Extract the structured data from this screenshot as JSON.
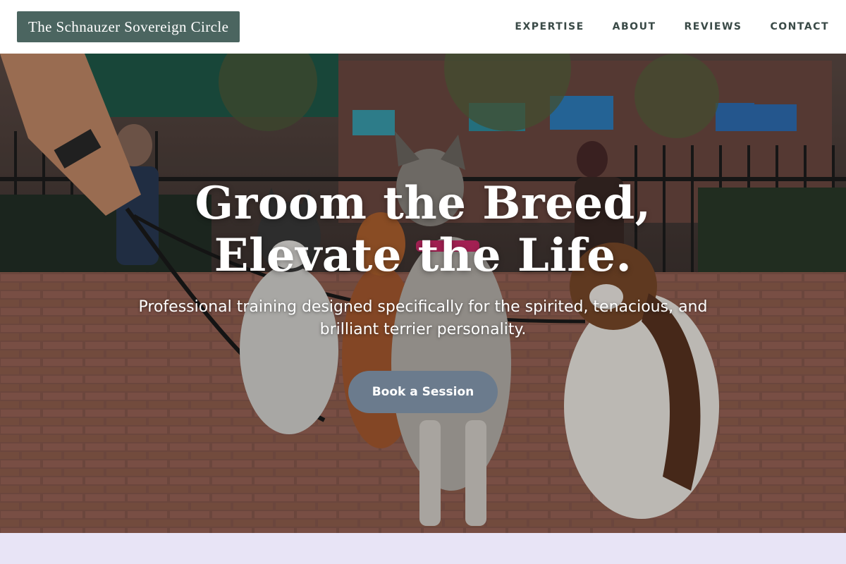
{
  "header": {
    "brand": "The Schnauzer Sovereign Circle",
    "nav": [
      {
        "label": "EXPERTISE"
      },
      {
        "label": "ABOUT"
      },
      {
        "label": "REVIEWS"
      },
      {
        "label": "CONTACT"
      }
    ]
  },
  "hero": {
    "title_line1": "Groom the Breed,",
    "title_line2": "Elevate the Life.",
    "subtitle": "Professional training designed specifically for the spirited, tenacious, and brilliant terrier personality.",
    "cta_label": "Book a Session",
    "image_subject": "dogs-on-leash-in-park-photo"
  },
  "colors": {
    "brand_bg": "#4b6560",
    "nav_text": "#3a4a47",
    "cta_bg": "#6b7b8d",
    "next_section_bg": "#e8e4f6"
  }
}
